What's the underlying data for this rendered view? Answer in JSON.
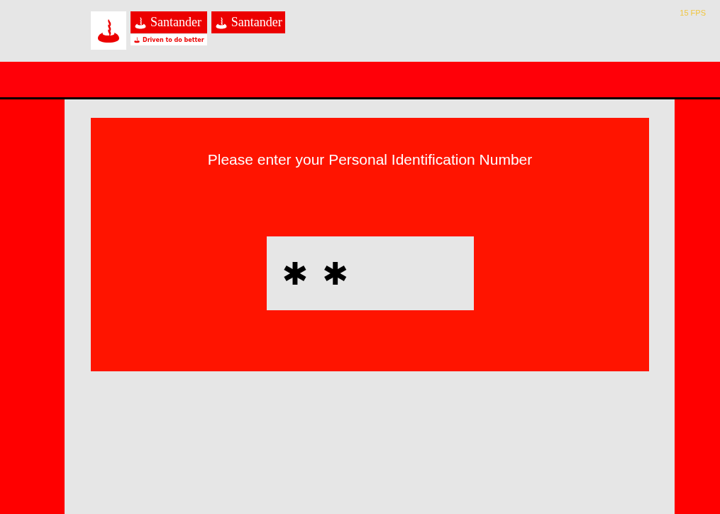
{
  "header": {
    "logos": [
      {
        "kind": "emblem"
      },
      {
        "kind": "wordmark_tagline",
        "name": "Santander",
        "tagline": "Driven to do better"
      },
      {
        "kind": "wordmark",
        "name": "Santander"
      }
    ],
    "fps": "15 FPS"
  },
  "prompt": "Please enter your Personal Identification Number",
  "pin_field": {
    "value": "✱✱"
  }
}
